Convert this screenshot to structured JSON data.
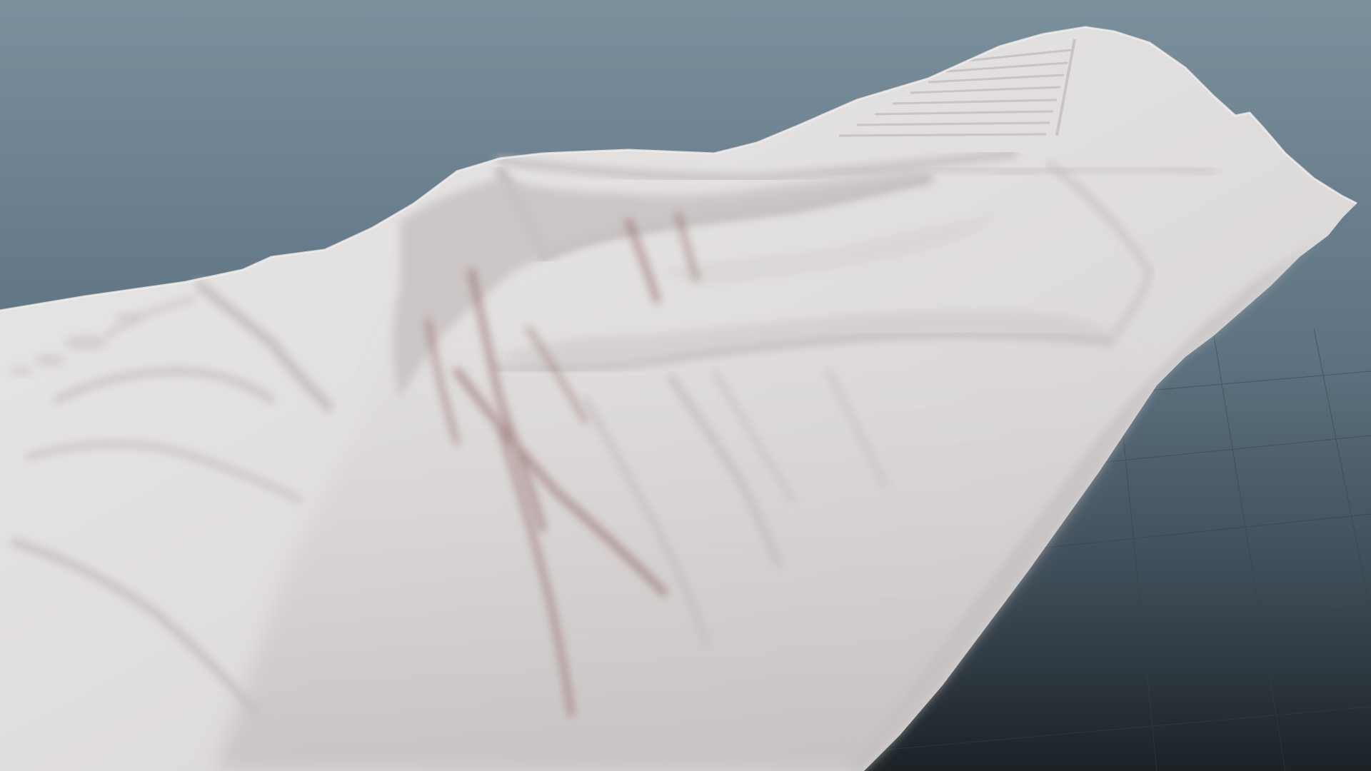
{
  "scene": {
    "subject": "terrain-mesh",
    "colors": {
      "sky_top": "#7b909d",
      "sky_mid": "#5c7281",
      "ground_far": "#3e4c57",
      "ground_near": "#1c2226",
      "grid_line": "#34414a",
      "mesh_light": "#ebe9e9",
      "mesh_mid": "#d9d6d6",
      "mesh_shadow": "#bdb7b7",
      "gully_tint": "#8a5a5a"
    }
  }
}
